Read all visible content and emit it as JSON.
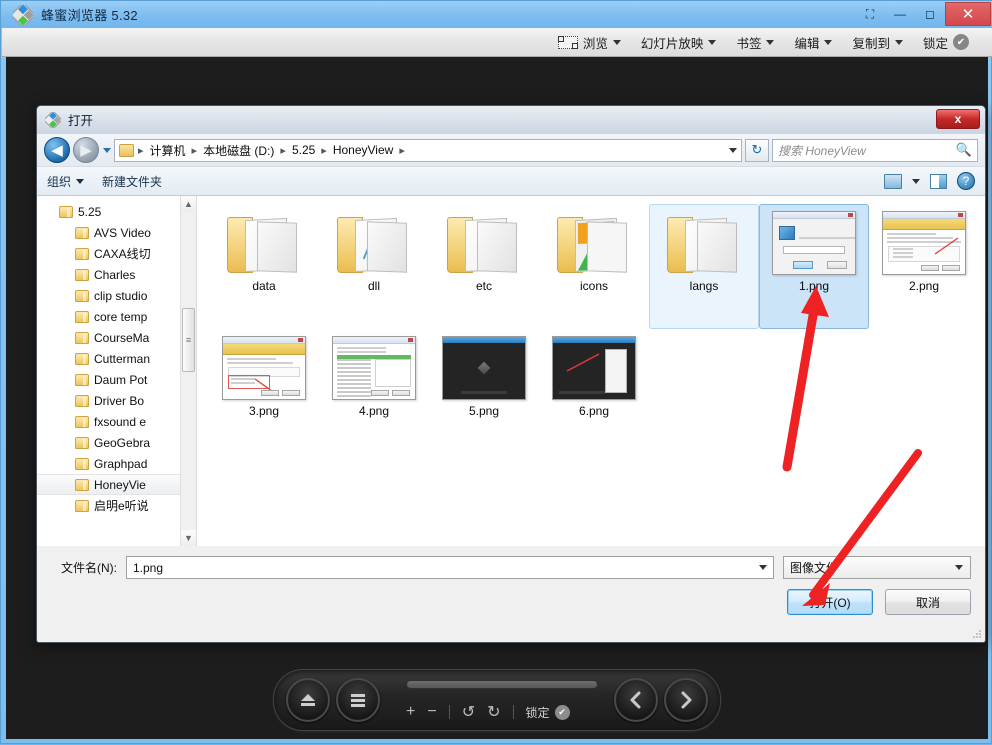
{
  "window": {
    "title": "蜂蜜浏览器 5.32",
    "app_icon": "honeyview-diamond-icon",
    "controls": {
      "fullscreen": "⛶",
      "minimize": "—",
      "maximize": "◻",
      "close": "✕"
    }
  },
  "app_toolbar": {
    "items": [
      {
        "label": "浏览",
        "icon": "crop-frame-icon",
        "has_caret": true
      },
      {
        "label": "幻灯片放映",
        "icon": "",
        "has_caret": true
      },
      {
        "label": "书签",
        "icon": "",
        "has_caret": true
      },
      {
        "label": "编辑",
        "icon": "",
        "has_caret": true
      },
      {
        "label": "复制到",
        "icon": "",
        "has_caret": true
      },
      {
        "label": "锁定",
        "icon": "check-circle-icon",
        "has_caret": false
      }
    ]
  },
  "dialog": {
    "title": "打开",
    "icon": "honeyview-diamond-icon",
    "close_label": "x",
    "nav": {
      "back": "◀",
      "forward": "▶",
      "refresh": "↻"
    },
    "breadcrumb": [
      "计算机",
      "本地磁盘 (D:)",
      "5.25",
      "HoneyView"
    ],
    "breadcrumb_separator": "▸",
    "search_placeholder": "搜索 HoneyView",
    "search_icon": "magnifier-icon",
    "command_bar": {
      "organize": "组织",
      "new_folder": "新建文件夹",
      "view_icon": "view-mode-icon",
      "pane_icon": "preview-pane-icon",
      "help_icon": "help-icon"
    },
    "tree": {
      "items": [
        {
          "label": "5.25",
          "level": 0,
          "selected": false
        },
        {
          "label": "AVS Video",
          "level": 1,
          "selected": false
        },
        {
          "label": "CAXA线切",
          "level": 1,
          "selected": false
        },
        {
          "label": "Charles",
          "level": 1,
          "selected": false
        },
        {
          "label": "clip studio",
          "level": 1,
          "selected": false
        },
        {
          "label": "core temp",
          "level": 1,
          "selected": false
        },
        {
          "label": "CourseMa",
          "level": 1,
          "selected": false
        },
        {
          "label": "Cutterman",
          "level": 1,
          "selected": false
        },
        {
          "label": "Daum Pot",
          "level": 1,
          "selected": false
        },
        {
          "label": "Driver Bo",
          "level": 1,
          "selected": false
        },
        {
          "label": "fxsound e",
          "level": 1,
          "selected": false
        },
        {
          "label": "GeoGebra",
          "level": 1,
          "selected": false
        },
        {
          "label": "Graphpad",
          "level": 1,
          "selected": false
        },
        {
          "label": "HoneyVie",
          "level": 1,
          "selected": true
        },
        {
          "label": "启明e听说",
          "level": 1,
          "selected": false
        }
      ],
      "scroll_up": "▲",
      "scroll_down": "▼"
    },
    "files": [
      {
        "name": "data",
        "type": "folder",
        "state": "normal"
      },
      {
        "name": "dll",
        "type": "folder",
        "state": "normal"
      },
      {
        "name": "etc",
        "type": "folder",
        "state": "normal"
      },
      {
        "name": "icons",
        "type": "folder-colorful",
        "state": "normal"
      },
      {
        "name": "langs",
        "type": "folder",
        "state": "hovered"
      },
      {
        "name": "1.png",
        "type": "image-dialog",
        "state": "selected"
      },
      {
        "name": "2.png",
        "type": "image-installer",
        "state": "normal"
      },
      {
        "name": "3.png",
        "type": "image-installer2",
        "state": "normal"
      },
      {
        "name": "4.png",
        "type": "image-list",
        "state": "normal"
      },
      {
        "name": "5.png",
        "type": "image-dark",
        "state": "normal"
      },
      {
        "name": "6.png",
        "type": "image-dark-menu",
        "state": "normal"
      }
    ],
    "footer": {
      "filename_label": "文件名(N):",
      "filename_value": "1.png",
      "filetype_value": "图像文件",
      "open_button": "打开(O)",
      "cancel_button": "取消"
    }
  },
  "control_bar": {
    "eject_icon": "eject-icon",
    "menu_icon": "hamburger-menu-icon",
    "zoom_in": "+",
    "zoom_out": "−",
    "rotate_left": "↺",
    "rotate_right": "↻",
    "lock_label": "锁定",
    "lock_icon": "check-circle-icon",
    "prev_icon": "‹",
    "next_icon": "›"
  },
  "annotations": {
    "arrow_color": "#ee2222",
    "arrow1_target": "1.png",
    "arrow2_target": "打开(O)"
  }
}
